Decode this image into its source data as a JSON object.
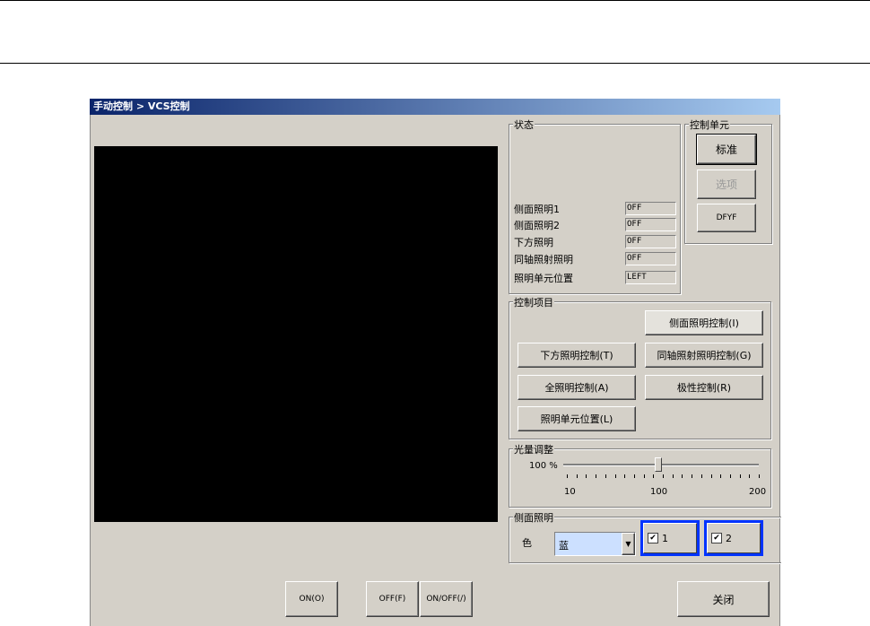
{
  "window": {
    "title": "手动控制 > VCS控制"
  },
  "status": {
    "legend": "状态",
    "rows": [
      {
        "label": "侧面照明1",
        "value": "OFF"
      },
      {
        "label": "侧面照明2",
        "value": "OFF"
      },
      {
        "label": "下方照明",
        "value": "OFF"
      },
      {
        "label": "同轴照射照明",
        "value": "OFF"
      },
      {
        "label": "照明单元位置",
        "value": "LEFT"
      }
    ]
  },
  "unit": {
    "legend": "控制单元",
    "standard": "标准",
    "option": "选项",
    "dfyf": "DFYF"
  },
  "items": {
    "legend": "控制项目",
    "side": "侧面照明控制(I)",
    "bottom": "下方照明控制(T)",
    "coaxial": "同轴照射照明控制(G)",
    "all": "全照明控制(A)",
    "polarity": "极性控制(R)",
    "position": "照明单元位置(L)"
  },
  "light": {
    "legend": "光量调整",
    "readout": "100 %",
    "value": 100,
    "min_label": "10",
    "mid_label": "100",
    "max_label": "200"
  },
  "side": {
    "legend": "侧面照明",
    "color_label": "色",
    "color_value": "蓝",
    "ch1": "1",
    "ch2": "2",
    "check_mark": "✔"
  },
  "footer": {
    "on": "ON(O)",
    "off": "OFF(F)",
    "onoff": "ON/OFF(/)",
    "close": "关闭"
  }
}
